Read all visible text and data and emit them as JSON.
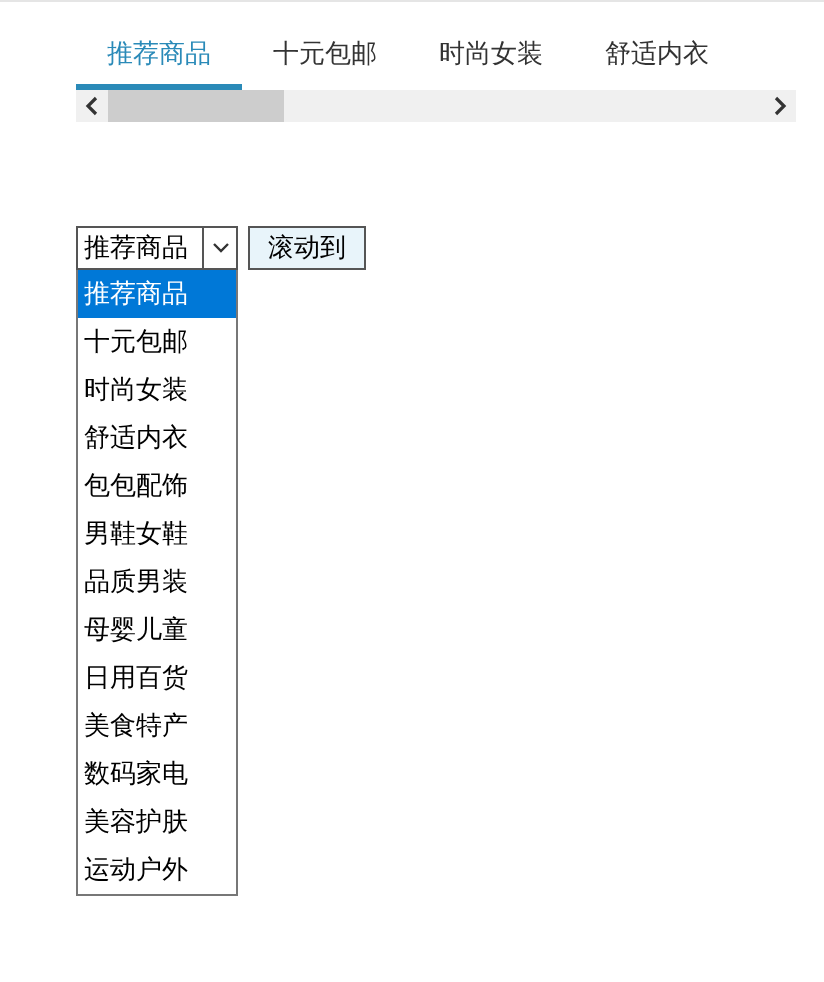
{
  "tabs": [
    {
      "label": "推荐商品",
      "selected": true
    },
    {
      "label": "十元包邮",
      "selected": false
    },
    {
      "label": "时尚女装",
      "selected": false
    },
    {
      "label": "舒适内衣",
      "selected": false
    }
  ],
  "select": {
    "value": "推荐商品",
    "expanded": true,
    "options": [
      {
        "label": "推荐商品",
        "selected": true
      },
      {
        "label": "十元包邮",
        "selected": false
      },
      {
        "label": "时尚女装",
        "selected": false
      },
      {
        "label": "舒适内衣",
        "selected": false
      },
      {
        "label": "包包配饰",
        "selected": false
      },
      {
        "label": "男鞋女鞋",
        "selected": false
      },
      {
        "label": "品质男装",
        "selected": false
      },
      {
        "label": "母婴儿童",
        "selected": false
      },
      {
        "label": "日用百货",
        "selected": false
      },
      {
        "label": "美食特产",
        "selected": false
      },
      {
        "label": "数码家电",
        "selected": false
      },
      {
        "label": "美容护肤",
        "selected": false
      },
      {
        "label": "运动户外",
        "selected": false
      }
    ]
  },
  "button": "滚动到"
}
